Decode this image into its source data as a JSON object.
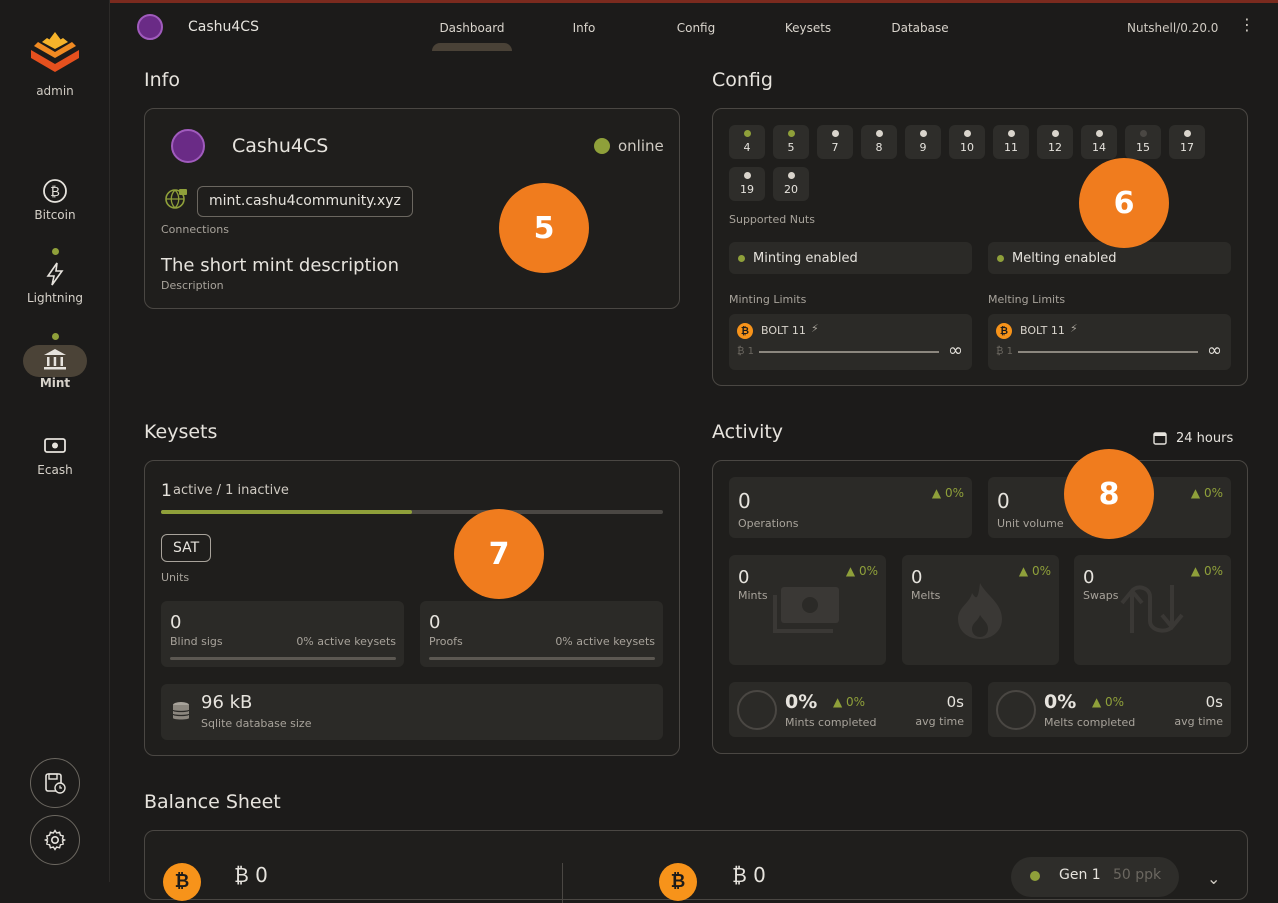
{
  "sidebar": {
    "user": "admin",
    "items": [
      {
        "label": "Bitcoin"
      },
      {
        "label": "Lightning"
      },
      {
        "label": "Mint"
      },
      {
        "label": "Ecash"
      }
    ]
  },
  "topbar": {
    "title": "Cashu4CS",
    "tabs": [
      "Dashboard",
      "Info",
      "Config",
      "Keysets",
      "Database"
    ],
    "version": "Nutshell/0.20.0"
  },
  "info": {
    "heading": "Info",
    "name": "Cashu4CS",
    "status": "online",
    "url": "mint.cashu4community.xyz",
    "connections_label": "Connections",
    "description": "The short mint description",
    "description_label": "Description",
    "badge": "5"
  },
  "config": {
    "heading": "Config",
    "nuts": [
      "4",
      "5",
      "7",
      "8",
      "9",
      "10",
      "11",
      "12",
      "14",
      "15",
      "17",
      "19",
      "20"
    ],
    "nuts_label": "Supported Nuts",
    "minting": "Minting enabled",
    "melting": "Melting enabled",
    "minting_limits_label": "Minting Limits",
    "melting_limits_label": "Melting Limits",
    "bolt": "BOLT 11",
    "min_value": "₿ 1",
    "max_value": "∞",
    "badge": "6"
  },
  "keysets": {
    "heading": "Keysets",
    "active_count": "1",
    "active_text": "active / 1 inactive",
    "active_fraction": 0.5,
    "unit": "SAT",
    "units_label": "Units",
    "blind_sigs_value": "0",
    "blind_sigs_label": "Blind sigs",
    "blind_sigs_pct": "0% active keysets",
    "proofs_value": "0",
    "proofs_label": "Proofs",
    "proofs_pct": "0% active keysets",
    "db_size": "96 kB",
    "db_label": "Sqlite database size",
    "badge": "7"
  },
  "activity": {
    "heading": "Activity",
    "range": "24 hours",
    "operations_value": "0",
    "operations_label": "Operations",
    "operations_change": "▲ 0%",
    "unit_volume_value": "0",
    "unit_volume_label": "Unit volume",
    "unit_volume_change": "▲ 0%",
    "mints_value": "0",
    "mints_label": "Mints",
    "mints_change": "▲ 0%",
    "melts_value": "0",
    "melts_label": "Melts",
    "melts_change": "▲ 0%",
    "swaps_value": "0",
    "swaps_label": "Swaps",
    "swaps_change": "▲ 0%",
    "mints_completed_value": "0%",
    "mints_completed_change": "▲ 0%",
    "mints_completed_label": "Mints completed",
    "mints_avg_value": "0s",
    "mints_avg_label": "avg time",
    "melts_completed_value": "0%",
    "melts_completed_change": "▲ 0%",
    "melts_completed_label": "Melts completed",
    "melts_avg_value": "0s",
    "melts_avg_label": "avg time",
    "badge": "8"
  },
  "balance": {
    "heading": "Balance Sheet",
    "left_value": "₿ 0",
    "right_value": "₿ 0",
    "gen_label": "Gen 1",
    "gen_ppk": "50 ppk"
  }
}
